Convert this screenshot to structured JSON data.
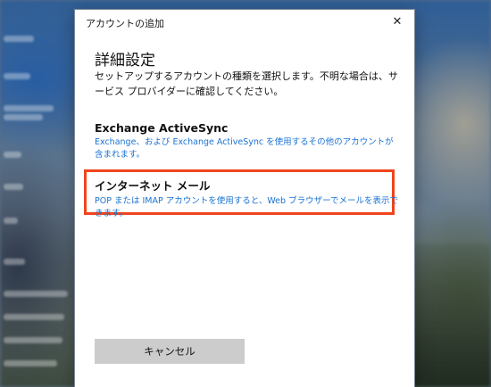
{
  "dialog": {
    "title": "アカウントの追加",
    "close_glyph": "✕",
    "heading": "詳細設定",
    "description": "セットアップするアカウントの種類を選択します。不明な場合は、サービス プロバイダーに確認してください。",
    "options": [
      {
        "title": "Exchange ActiveSync",
        "subtitle": "Exchange、および Exchange ActiveSync を使用するその他のアカウントが含まれます。"
      },
      {
        "title": "インターネット メール",
        "subtitle": "POP または IMAP アカウントを使用すると、Web ブラウザーでメールを表示できます。"
      }
    ],
    "cancel_label": "キャンセル"
  },
  "colors": {
    "highlight_border": "#f0441c",
    "link_blue": "#1a73d0",
    "button_gray": "#cccccc"
  },
  "icons": {
    "close": "close-icon"
  }
}
